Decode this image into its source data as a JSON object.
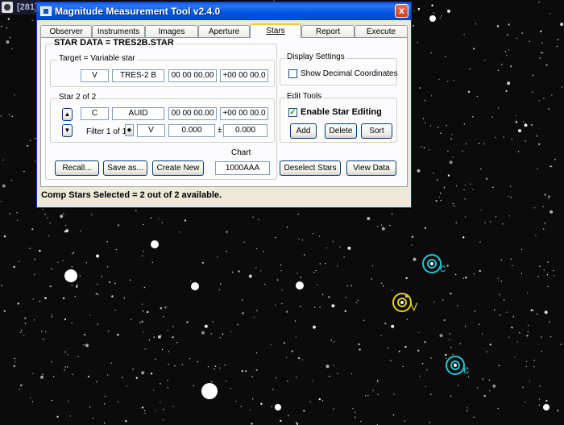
{
  "background_window": {
    "title": "[281]"
  },
  "window": {
    "title": "Magnitude Measurement Tool v2.4.0",
    "close_label": "x",
    "tabs": [
      "Observer",
      "Instruments",
      "Images",
      "Aperture",
      "Stars",
      "Report",
      "Execute"
    ],
    "active_tab": "Stars",
    "status": "Comp Stars Selected = 2 out of 2 available."
  },
  "star_data": {
    "title": "STAR DATA = TRES2B.STAR",
    "target": {
      "label": "Target = Variable star",
      "type": "V",
      "name": "TRES-2 B",
      "ra": "00 00 00.00",
      "dec": "+00 00 00.0"
    },
    "star": {
      "label": "Star 2 of 2",
      "type": "C",
      "name": "AUID",
      "ra": "00 00 00.00",
      "dec": "+00 00 00.0",
      "filter_label": "Filter 1 of 1",
      "filter": "V",
      "magnitude": "0.000",
      "plus_minus": "±",
      "error": "0.000"
    }
  },
  "display_settings": {
    "label": "Display Settings",
    "show_decimal_label": "Show Decimal Coordinates",
    "show_decimal_checked": false
  },
  "edit_tools": {
    "label": "Edit Tools",
    "enable_label": "Enable Star Editing",
    "enable_checked": true,
    "add_label": "Add",
    "delete_label": "Delete",
    "sort_label": "Sort"
  },
  "bottom": {
    "recall_label": "Recall...",
    "save_as_label": "Save as...",
    "create_new_label": "Create New",
    "chart_label": "Chart",
    "chart_value": "1000AAA",
    "deselect_label": "Deselect Stars",
    "view_data_label": "View Data"
  },
  "sky_markers": [
    {
      "label": "c",
      "color": "#22c8d8"
    },
    {
      "label": "V",
      "color": "#e6d21a"
    },
    {
      "label": "c",
      "color": "#22c8d8"
    }
  ],
  "icons": {
    "app": "app-icon",
    "close": "close-icon",
    "arrow_up": "arrow-up-icon",
    "arrow_down": "arrow-down-icon"
  }
}
